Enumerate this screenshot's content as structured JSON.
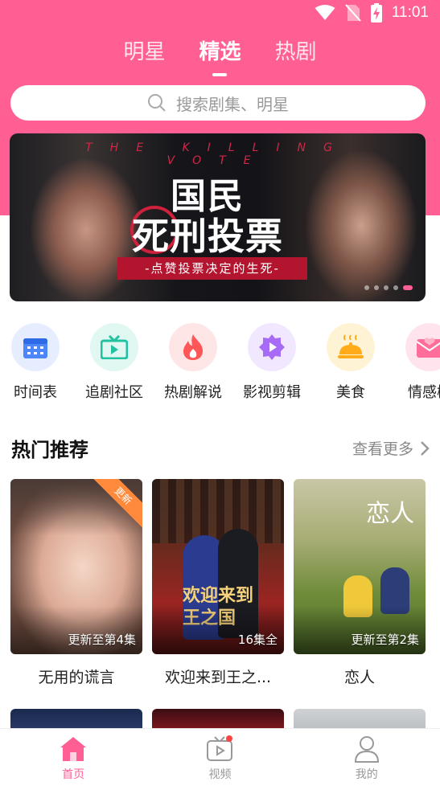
{
  "status": {
    "time": "11:01"
  },
  "tabs": [
    {
      "label": "明星",
      "active": false
    },
    {
      "label": "精选",
      "active": true
    },
    {
      "label": "热剧",
      "active": false
    }
  ],
  "search": {
    "placeholder": "搜索剧集、明星",
    "icon": "search-icon"
  },
  "banner": {
    "english_title": "THE KILLING VOTE",
    "title_line1": "国民",
    "title_line2": "死刑投票",
    "subtitle": "-点赞投票决定的生死-",
    "slide_count": 5,
    "active_slide": 5
  },
  "categories": [
    {
      "label": "时间表",
      "icon": "calendar-icon",
      "bg": "#e6edff",
      "color": "#4d86f7"
    },
    {
      "label": "追剧社区",
      "icon": "tv-icon",
      "bg": "#e1f7f2",
      "color": "#22c1a0"
    },
    {
      "label": "热剧解说",
      "icon": "fire-icon",
      "bg": "#ffe6e6",
      "color": "#ff5757"
    },
    {
      "label": "影视剪辑",
      "icon": "play-badge-icon",
      "bg": "#f1e8ff",
      "color": "#a86bf5"
    },
    {
      "label": "美食",
      "icon": "food-cloche-icon",
      "bg": "#fff3d6",
      "color": "#ffab1a"
    },
    {
      "label": "情感树",
      "icon": "love-letter-icon",
      "bg": "#ffe4ee",
      "color": "#ff6d9a"
    }
  ],
  "hot": {
    "title": "热门推荐",
    "more": "查看更多",
    "items": [
      {
        "title": "无用的谎言",
        "episode": "更新至第4集",
        "tag": "更新"
      },
      {
        "title": "欢迎来到王之...",
        "episode": "16集全",
        "poster_text": "欢迎来到王之国"
      },
      {
        "title": "恋人",
        "episode": "更新至第2集",
        "poster_text": "恋人"
      }
    ]
  },
  "bottom_nav": [
    {
      "label": "首页",
      "icon": "home-icon",
      "active": true
    },
    {
      "label": "视频",
      "icon": "video-icon",
      "active": false,
      "badge": true
    },
    {
      "label": "我的",
      "icon": "profile-icon",
      "active": false
    }
  ],
  "colors": {
    "accent": "#ff5f93"
  }
}
